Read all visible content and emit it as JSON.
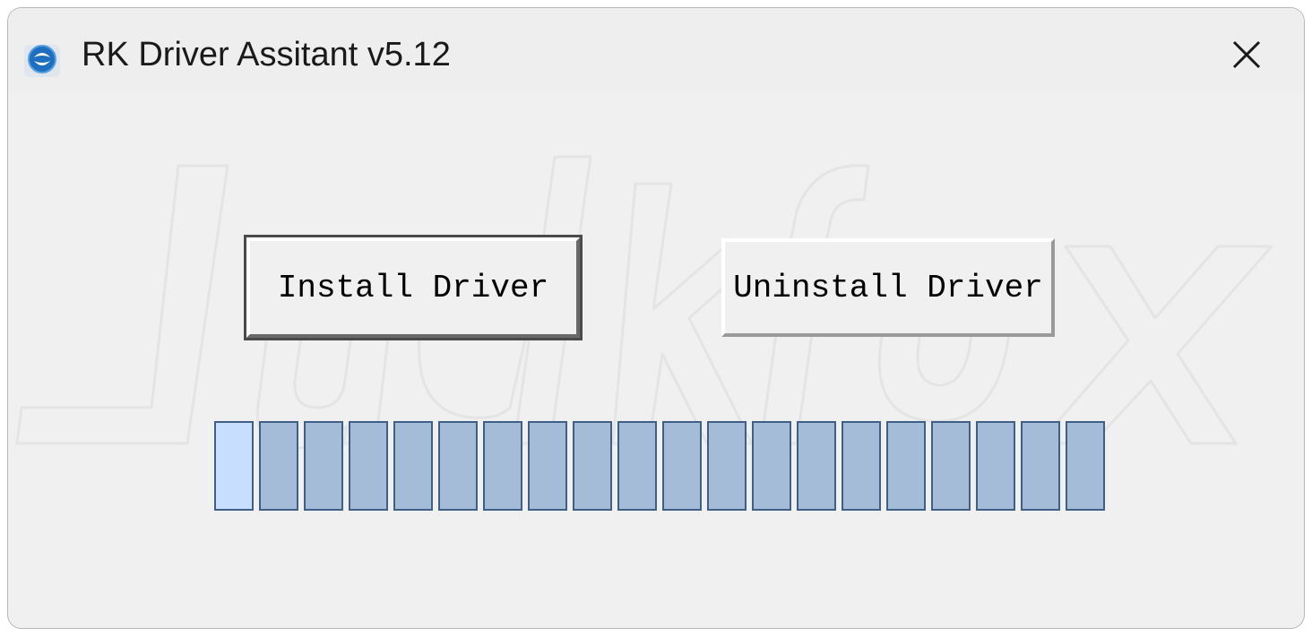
{
  "window": {
    "title": "RK Driver Assitant v5.12",
    "icon": "app-logo-icon",
    "close_icon": "close-icon"
  },
  "buttons": {
    "install_label": "Install Driver",
    "uninstall_label": "Uninstall Driver"
  },
  "watermark": {
    "text": "Luckfox"
  },
  "progress": {
    "segments_total": 20,
    "segments_highlighted": 1,
    "fill_color": "#a4bcd8",
    "highlight_color": "#c8deff",
    "border_color": "#3f5f86"
  },
  "colors": {
    "window_bg": "#f0f0f0",
    "titlebar_bg": "#eeeeee"
  }
}
